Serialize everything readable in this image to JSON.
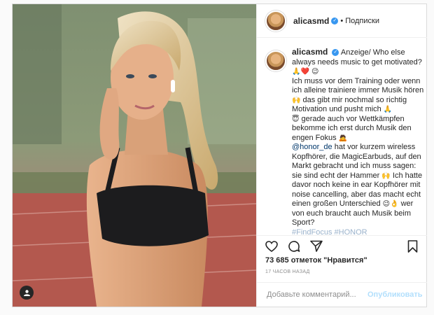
{
  "header": {
    "username": "alicasmd",
    "separator": "•",
    "follow_label": "Подписки"
  },
  "caption": {
    "username": "alicasmd",
    "p1": "Anzeige/ Who else always needs music to get motivated?",
    "p1_emoji": "🙏❤️",
    "p1_emoji2": "😉",
    "p2": "Ich muss vor dem Training oder wenn ich alleine trainiere immer Musik hören",
    "p2_emoji": "🙌",
    "p2b": "das gibt mir nochmal so richtig Motivation und pusht mich",
    "p2b_emoji": "🙏",
    "p3_emoji": "😇",
    "p3": "gerade auch vor Wettkämpfen bekomme ich erst durch Musik den engen Fokus",
    "p3_emoji2": "🙇",
    "mention": "@honor_de",
    "p4": "hat vor kurzem wireless Kopfhörer, die MagicEarbuds, auf den Markt gebracht und ich muss sagen: sie sind echt der Hammer",
    "p4_emoji": "🙌",
    "p5": "Ich hatte davor noch keine in ear Kopfhörer mit noise cancelling, aber das macht echt einen großen Unterschied",
    "p5_emoji": "😉👌",
    "p6": "wer von euch braucht auch Musik beim Sport?",
    "hashtags": "#FindFocus #HONOR"
  },
  "stats": {
    "likes": "73 685 отметок \"Нравится\"",
    "time": "17 ЧАСОВ НАЗАД"
  },
  "comment_box": {
    "placeholder": "Добавьте комментарий...",
    "publish_label": "Опубликовать"
  },
  "icons": {
    "like": "heart-icon",
    "comment": "comment-icon",
    "share": "share-icon",
    "save": "bookmark-icon",
    "tag": "user-tag-icon"
  },
  "colors": {
    "verified": "#3897f0",
    "mention": "#00376b",
    "publish_disabled": "#b2dffc",
    "track": "#b5564e"
  }
}
